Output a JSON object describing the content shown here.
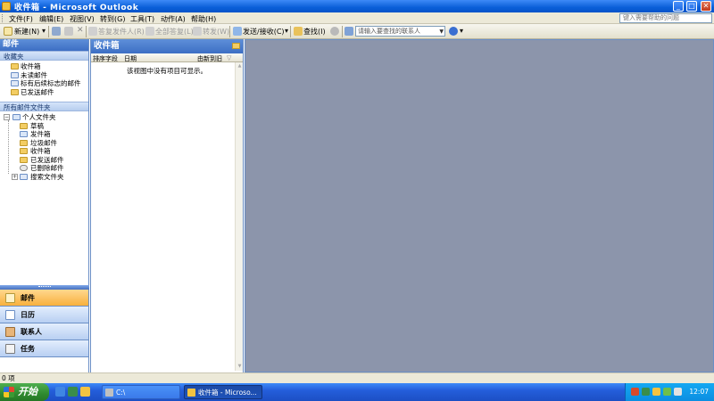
{
  "window": {
    "title": "收件箱 - Microsoft Outlook",
    "controls": {
      "minimize": "_",
      "maximize": "□",
      "close": "✕"
    }
  },
  "menubar": {
    "items": [
      "文件(F)",
      "编辑(E)",
      "视图(V)",
      "转到(G)",
      "工具(T)",
      "动作(A)",
      "帮助(H)"
    ],
    "help_placeholder": "键入需要帮助的问题"
  },
  "toolbar": {
    "new_label": "新建(N)",
    "reply_label": "答复发件人(R)",
    "reply_all_label": "全部答复(L)",
    "forward_label": "转发(W)",
    "send_receive_label": "发送/接收(C)",
    "find_label": "查找(I)",
    "contact_search_placeholder": "请输入要查找的联系人"
  },
  "navpane": {
    "title": "邮件",
    "favorites_heading": "收藏夹",
    "favorites": [
      "收件箱",
      "未读邮件",
      "标有后续标志的邮件",
      "已发送邮件"
    ],
    "all_folders_heading": "所有邮件文件夹",
    "root_folder": "个人文件夹",
    "folders": [
      "草稿",
      "发件箱",
      "垃圾邮件",
      "收件箱",
      "已发送邮件",
      "已删除邮件",
      "搜索文件夹"
    ],
    "buttons": [
      "邮件",
      "日历",
      "联系人",
      "任务"
    ]
  },
  "msglist": {
    "title": "收件箱",
    "col_arrange": "排序字段",
    "col_date": "日期",
    "col_order": "由新到旧",
    "empty_text": "该视图中没有项目可显示。"
  },
  "statusbar": {
    "text": "0 项"
  },
  "taskbar": {
    "start_label": "开始",
    "tasks": [
      "C:\\",
      "收件箱 - Microso..."
    ],
    "clock": "12:07"
  },
  "colors": {
    "title_blue": "#0a5fd8",
    "pane_header": "#3d6fc4",
    "reading_pane": "#8c95ab",
    "active_nav": "#f8b03d"
  }
}
